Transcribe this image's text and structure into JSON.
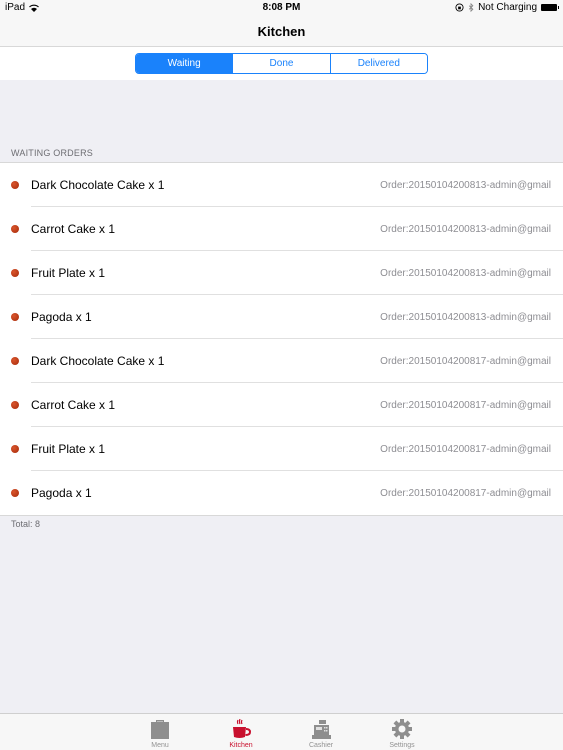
{
  "status_bar": {
    "device": "iPad",
    "time": "8:08 PM",
    "charging": "Not Charging"
  },
  "nav": {
    "title": "Kitchen"
  },
  "segments": [
    {
      "label": "Waiting",
      "active": true
    },
    {
      "label": "Done",
      "active": false
    },
    {
      "label": "Delivered",
      "active": false
    }
  ],
  "section": {
    "header": "WAITING ORDERS",
    "footer": "Total: 8"
  },
  "orders": [
    {
      "item": "Dark Chocolate Cake x 1",
      "order": "Order:20150104200813-admin@gmail"
    },
    {
      "item": "Carrot Cake x 1",
      "order": "Order:20150104200813-admin@gmail"
    },
    {
      "item": "Fruit Plate x 1",
      "order": "Order:20150104200813-admin@gmail"
    },
    {
      "item": "Pagoda x 1",
      "order": "Order:20150104200813-admin@gmail"
    },
    {
      "item": "Dark Chocolate Cake x 1",
      "order": "Order:20150104200817-admin@gmail"
    },
    {
      "item": "Carrot Cake x 1",
      "order": "Order:20150104200817-admin@gmail"
    },
    {
      "item": "Fruit Plate x 1",
      "order": "Order:20150104200817-admin@gmail"
    },
    {
      "item": "Pagoda x 1",
      "order": "Order:20150104200817-admin@gmail"
    }
  ],
  "tabs": [
    {
      "label": "Menu",
      "icon": "clipboard-icon",
      "active": false
    },
    {
      "label": "Kitchen",
      "icon": "coffee-cup-icon",
      "active": true
    },
    {
      "label": "Cashier",
      "icon": "cash-register-icon",
      "active": false
    },
    {
      "label": "Settings",
      "icon": "gear-icon",
      "active": false
    }
  ],
  "colors": {
    "accent": "#1a82fb",
    "active_tab": "#c8102e",
    "bullet": "#c0401a"
  }
}
